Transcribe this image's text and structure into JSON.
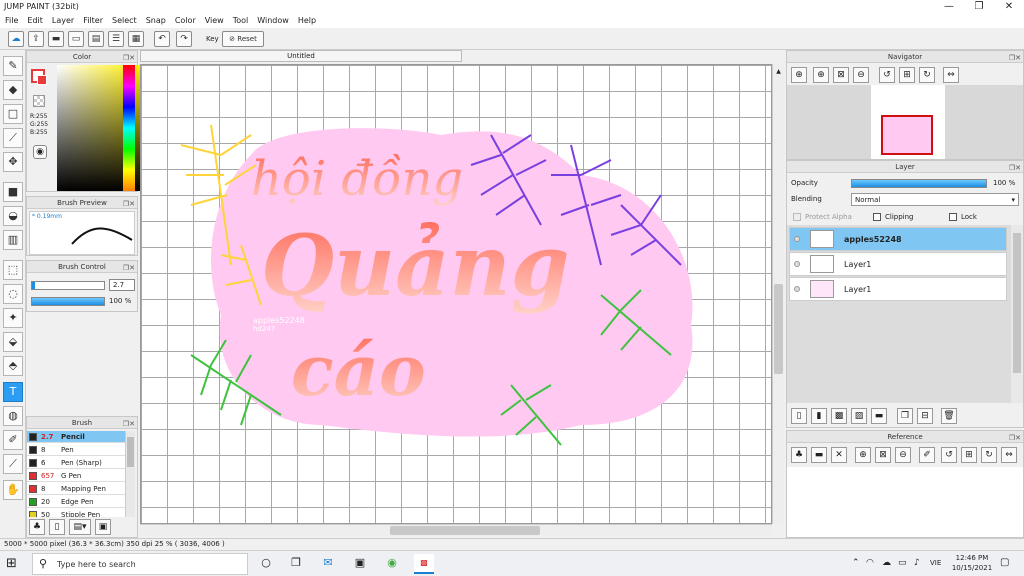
{
  "app": {
    "title": "JUMP PAINT (32bit)"
  },
  "window_controls": {
    "minimize": "—",
    "maximize": "❐",
    "close": "✕"
  },
  "menu": [
    "File",
    "Edit",
    "Layer",
    "Filter",
    "Select",
    "Snap",
    "Color",
    "View",
    "Tool",
    "Window",
    "Help"
  ],
  "toolbar": {
    "key_label": "Key",
    "reset_label": "Reset"
  },
  "color_panel": {
    "title": "Color",
    "r": "R:255",
    "g": "G:255",
    "b": "B:255",
    "accent": "#e83a3a"
  },
  "brush_preview": {
    "title": "Brush Preview",
    "size": "* 0.19mm"
  },
  "brush_control": {
    "title": "Brush Control",
    "size_value": "2.7",
    "opacity_value": "100 %",
    "opacity_fraction": 1.0
  },
  "brush_panel": {
    "title": "Brush",
    "items": [
      {
        "size": "2.7",
        "name": "Pencil",
        "color": "#222222",
        "selected": true
      },
      {
        "size": "8",
        "name": "Pen",
        "color": "#222222",
        "selected": false
      },
      {
        "size": "6",
        "name": "Pen (Sharp)",
        "color": "#222222",
        "selected": false
      },
      {
        "size": "657",
        "name": "G Pen",
        "color": "#e03030",
        "selected": false
      },
      {
        "size": "8",
        "name": "Mapping Pen",
        "color": "#e03030",
        "selected": false
      },
      {
        "size": "20",
        "name": "Edge Pen",
        "color": "#22a022",
        "selected": false
      },
      {
        "size": "50",
        "name": "Stipple Pen",
        "color": "#e0d020",
        "selected": false
      }
    ]
  },
  "document": {
    "tab": "Untitled"
  },
  "artwork": {
    "line1": "hội đồng",
    "line2": "Quảng",
    "line3": "cáo",
    "signature_line1": "apples52248",
    "signature_line2": "hd247"
  },
  "status": {
    "text": "5000 * 5000 pixel  (36.3 * 36.3cm)  350 dpi  25 %  ( 3036, 4006 )"
  },
  "navigator": {
    "title": "Navigator"
  },
  "layer_panel": {
    "title": "Layer",
    "opacity_label": "Opacity",
    "opacity_value": "100 %",
    "opacity_fraction": 1.0,
    "blending_label": "Blending",
    "blending_value": "Normal",
    "protect_alpha": "Protect Alpha",
    "clipping": "Clipping",
    "lock": "Lock",
    "layers": [
      {
        "name": "apples52248",
        "selected": true
      },
      {
        "name": "Layer1",
        "selected": false
      },
      {
        "name": "Layer1",
        "selected": false
      }
    ]
  },
  "reference": {
    "title": "Reference"
  },
  "taskbar": {
    "search_placeholder": "Type here to search",
    "lang": "VIE",
    "time": "12:46 PM",
    "date": "10/15/2021"
  }
}
